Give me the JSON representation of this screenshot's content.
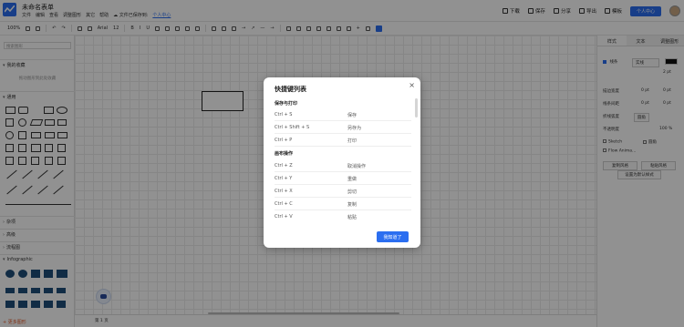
{
  "app": {
    "title": "未命名表单",
    "menus": [
      "文件",
      "编辑",
      "查看",
      "调整图形",
      "其它",
      "帮助"
    ],
    "saved_status": "文件已保存到:",
    "saved_location": "个人中心"
  },
  "top_actions": {
    "download": "下载",
    "save": "保存",
    "share": "分享",
    "export": "导出",
    "template": "模板",
    "personal_center": "个人中心"
  },
  "toolbar": {
    "zoom": "100%",
    "font": "Arial",
    "font_size": "12"
  },
  "left_panel": {
    "search_placeholder": "搜索图形",
    "my_favorites": "我的收藏",
    "drop_hint": "拖动图形到此处收藏",
    "general": "通用",
    "misc": "杂项",
    "advanced": "高级",
    "flowchart": "流程图",
    "infographic": "Infographic",
    "more_shapes": "+ 更多图形"
  },
  "right_panel": {
    "tabs": [
      "样式",
      "文本",
      "调整图形"
    ],
    "line_label": "线条",
    "line_style": "实线",
    "line_width": "2 pt",
    "perimeter": "描边宽度",
    "perimeter_values": [
      "0 pt",
      "0 pt"
    ],
    "spacing": "线条间距",
    "spacing_values": [
      "0 pt",
      "0 pt"
    ],
    "arc": "折线弧度",
    "arc_value": "圆角",
    "opacity_label": "不透明度",
    "opacity_value": "100 %",
    "sketch": "Sketch",
    "rounded": "圆角",
    "flow_anim": "Flow Anima...",
    "copy_style": "复制风格",
    "paste_style": "粘贴风格",
    "set_default": "设置为默认样式"
  },
  "page": {
    "page_label": "第 1 页"
  },
  "dialog": {
    "title": "快捷键列表",
    "sections": [
      {
        "title": "保存与打印",
        "rows": [
          {
            "key": "Ctrl + S",
            "desc": "保存"
          },
          {
            "key": "Ctrl + Shift + S",
            "desc": "另存为"
          },
          {
            "key": "Ctrl + P",
            "desc": "打印"
          }
        ]
      },
      {
        "title": "画布操作",
        "rows": [
          {
            "key": "Ctrl + Z",
            "desc": "取消操作"
          },
          {
            "key": "Ctrl + Y",
            "desc": "重做"
          },
          {
            "key": "Ctrl + X",
            "desc": "剪切"
          },
          {
            "key": "Ctrl + C",
            "desc": "复制"
          },
          {
            "key": "Ctrl + V",
            "desc": "粘贴"
          }
        ]
      }
    ],
    "ok_button": "我知道了"
  },
  "colors": {
    "accent": "#2b6ef0",
    "overlay": "#000000",
    "more_shapes": "#e25b2c"
  }
}
